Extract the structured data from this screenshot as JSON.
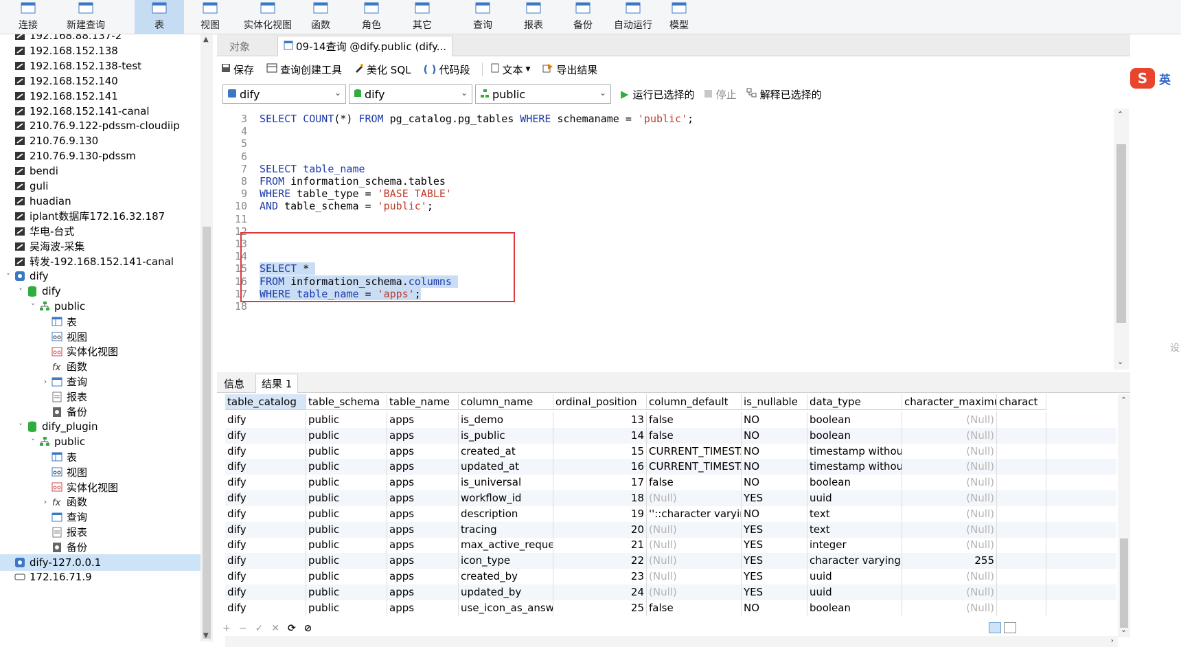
{
  "toolbar": {
    "items": [
      {
        "label": "连接",
        "icon": "plug-icon"
      },
      {
        "label": "新建查询",
        "icon": "new-query-icon"
      },
      {
        "label": "表",
        "icon": "table-icon",
        "active": true
      },
      {
        "label": "视图",
        "icon": "view-icon"
      },
      {
        "label": "实体化视图",
        "icon": "materialized-view-icon"
      },
      {
        "label": "函数",
        "icon": "function-icon"
      },
      {
        "label": "角色",
        "icon": "role-icon"
      },
      {
        "label": "其它",
        "icon": "other-icon"
      },
      {
        "label": "查询",
        "icon": "query-icon"
      },
      {
        "label": "报表",
        "icon": "report-icon"
      },
      {
        "label": "备份",
        "icon": "backup-icon"
      },
      {
        "label": "自动运行",
        "icon": "autorun-icon"
      },
      {
        "label": "模型",
        "icon": "model-icon"
      }
    ]
  },
  "tree": {
    "items": [
      {
        "label": "192.168.88.137-2",
        "icon": "connection-icon"
      },
      {
        "label": "192.168.152.138",
        "icon": "connection-icon"
      },
      {
        "label": "192.168.152.138-test",
        "icon": "connection-icon"
      },
      {
        "label": "192.168.152.140",
        "icon": "connection-icon"
      },
      {
        "label": "192.168.152.141",
        "icon": "connection-icon"
      },
      {
        "label": "192.168.152.141-canal",
        "icon": "connection-icon"
      },
      {
        "label": "210.76.9.122-pdssm-cloudiip",
        "icon": "connection-icon"
      },
      {
        "label": "210.76.9.130",
        "icon": "connection-icon"
      },
      {
        "label": "210.76.9.130-pdssm",
        "icon": "connection-icon"
      },
      {
        "label": "bendi",
        "icon": "connection-icon"
      },
      {
        "label": "guli",
        "icon": "connection-icon"
      },
      {
        "label": "huadian",
        "icon": "connection-icon"
      },
      {
        "label": "iplant数据库172.16.32.187",
        "icon": "connection-icon"
      },
      {
        "label": "华电-台式",
        "icon": "connection-icon"
      },
      {
        "label": "吴海波-采集",
        "icon": "connection-icon"
      },
      {
        "label": "转发-192.168.152.141-canal",
        "icon": "connection-icon"
      },
      {
        "label": "dify",
        "icon": "pg-connection-icon",
        "arrow": "˅"
      },
      {
        "label": "dify",
        "icon": "database-icon",
        "arrow": "˅"
      },
      {
        "label": "public",
        "icon": "schema-icon",
        "arrow": "˅"
      },
      {
        "label": "表",
        "icon": "table-icon"
      },
      {
        "label": "视图",
        "icon": "view-icon"
      },
      {
        "label": "实体化视图",
        "icon": "materialized-view-icon"
      },
      {
        "label": "函数",
        "icon": "function-icon"
      },
      {
        "label": "查询",
        "icon": "query-icon",
        "arrow": "›"
      },
      {
        "label": "报表",
        "icon": "report-icon"
      },
      {
        "label": "备份",
        "icon": "backup-icon"
      },
      {
        "label": "dify_plugin",
        "icon": "database-icon",
        "arrow": "˅"
      },
      {
        "label": "public",
        "icon": "schema-icon",
        "arrow": "˅"
      },
      {
        "label": "表",
        "icon": "table-icon"
      },
      {
        "label": "视图",
        "icon": "view-icon"
      },
      {
        "label": "实体化视图",
        "icon": "materialized-view-icon"
      },
      {
        "label": "函数",
        "icon": "function-icon",
        "arrow": "›"
      },
      {
        "label": "查询",
        "icon": "query-icon"
      },
      {
        "label": "报表",
        "icon": "report-icon"
      },
      {
        "label": "备份",
        "icon": "backup-icon"
      },
      {
        "label": "dify-127.0.0.1",
        "icon": "pg-connection-icon",
        "selected": true
      },
      {
        "label": "172.16.71.9",
        "icon": "server-icon"
      }
    ]
  },
  "tabs": {
    "objects": "对象",
    "query_tab": "09-14查询 @dify.public (dify..."
  },
  "editor_toolbar": {
    "save": "保存",
    "query_builder": "查询创建工具",
    "beautify": "美化 SQL",
    "snippet": "代码段",
    "text": "文本",
    "export": "导出结果"
  },
  "selectors": {
    "connection": "dify",
    "database": "dify",
    "schema": "public",
    "run_selected": "运行已选择的",
    "stop": "停止",
    "explain_selected": "解释已选择的"
  },
  "editor": {
    "lines": [
      {
        "n": "3",
        "code": [
          [
            "kw",
            "SELECT "
          ],
          [
            "fn",
            "COUNT"
          ],
          [
            "",
            "(*) "
          ],
          [
            "kw",
            "FROM"
          ],
          [
            "",
            " pg_catalog.pg_tables "
          ],
          [
            "kw",
            "WHERE"
          ],
          [
            "",
            " schemaname = "
          ],
          [
            "str",
            "'public'"
          ],
          [
            "",
            ";"
          ]
        ]
      },
      {
        "n": "4",
        "code": []
      },
      {
        "n": "5",
        "code": []
      },
      {
        "n": "6",
        "code": []
      },
      {
        "n": "7",
        "code": [
          [
            "kw",
            "SELECT "
          ],
          [
            "fn",
            "table_name"
          ]
        ]
      },
      {
        "n": "8",
        "code": [
          [
            "kw",
            "FROM"
          ],
          [
            "",
            " information_schema.tables"
          ]
        ]
      },
      {
        "n": "9",
        "code": [
          [
            "kw",
            "WHERE"
          ],
          [
            "",
            " table_type = "
          ],
          [
            "str",
            "'BASE TABLE'"
          ]
        ]
      },
      {
        "n": "10",
        "code": [
          [
            "kw",
            "AND"
          ],
          [
            "",
            " table_schema = "
          ],
          [
            "str",
            "'public'"
          ],
          [
            "",
            ";"
          ]
        ]
      },
      {
        "n": "11",
        "code": []
      },
      {
        "n": "12",
        "code": []
      },
      {
        "n": "13",
        "code": []
      },
      {
        "n": "14",
        "code": []
      },
      {
        "n": "15",
        "code": [
          [
            "kw",
            "SELECT"
          ],
          [
            "",
            " * "
          ]
        ],
        "hl": true
      },
      {
        "n": "16",
        "code": [
          [
            "kw",
            "FROM"
          ],
          [
            "",
            " information_schema."
          ],
          [
            "fn",
            "columns"
          ],
          [
            "",
            " "
          ]
        ],
        "hl": true
      },
      {
        "n": "17",
        "code": [
          [
            "kw",
            "WHERE"
          ],
          [
            "",
            " "
          ],
          [
            "fn",
            "table_name"
          ],
          [
            "",
            " = "
          ],
          [
            "str",
            "'apps'"
          ],
          [
            "",
            ";"
          ]
        ],
        "hl": true
      },
      {
        "n": "18",
        "code": []
      }
    ]
  },
  "result_tabs": {
    "info": "信息",
    "result1": "结果 1"
  },
  "grid": {
    "columns": [
      "table_catalog",
      "table_schema",
      "table_name",
      "column_name",
      "ordinal_position",
      "column_default",
      "is_nullable",
      "data_type",
      "character_maximum",
      "charact"
    ],
    "rows": [
      [
        "dify",
        "public",
        "apps",
        "is_demo",
        "13",
        "false",
        "NO",
        "boolean",
        "(Null)",
        ""
      ],
      [
        "dify",
        "public",
        "apps",
        "is_public",
        "14",
        "false",
        "NO",
        "boolean",
        "(Null)",
        ""
      ],
      [
        "dify",
        "public",
        "apps",
        "created_at",
        "15",
        "CURRENT_TIMESTAM",
        "NO",
        "timestamp without t",
        "(Null)",
        ""
      ],
      [
        "dify",
        "public",
        "apps",
        "updated_at",
        "16",
        "CURRENT_TIMESTAM",
        "NO",
        "timestamp without t",
        "(Null)",
        ""
      ],
      [
        "dify",
        "public",
        "apps",
        "is_universal",
        "17",
        "false",
        "NO",
        "boolean",
        "(Null)",
        ""
      ],
      [
        "dify",
        "public",
        "apps",
        "workflow_id",
        "18",
        "(Null)",
        "YES",
        "uuid",
        "(Null)",
        ""
      ],
      [
        "dify",
        "public",
        "apps",
        "description",
        "19",
        "''::character varying",
        "NO",
        "text",
        "(Null)",
        ""
      ],
      [
        "dify",
        "public",
        "apps",
        "tracing",
        "20",
        "(Null)",
        "YES",
        "text",
        "(Null)",
        ""
      ],
      [
        "dify",
        "public",
        "apps",
        "max_active_requests",
        "21",
        "(Null)",
        "YES",
        "integer",
        "(Null)",
        ""
      ],
      [
        "dify",
        "public",
        "apps",
        "icon_type",
        "22",
        "(Null)",
        "YES",
        "character varying",
        "255",
        ""
      ],
      [
        "dify",
        "public",
        "apps",
        "created_by",
        "23",
        "(Null)",
        "YES",
        "uuid",
        "(Null)",
        ""
      ],
      [
        "dify",
        "public",
        "apps",
        "updated_by",
        "24",
        "(Null)",
        "YES",
        "uuid",
        "(Null)",
        ""
      ],
      [
        "dify",
        "public",
        "apps",
        "use_icon_as_answer_",
        "25",
        "false",
        "NO",
        "boolean",
        "(Null)",
        ""
      ]
    ]
  },
  "bottom": {
    "add": "+",
    "remove": "−",
    "apply": "✓",
    "discard": "✕",
    "refresh": "⟳",
    "stop": "⊘"
  },
  "ime": {
    "label": "英"
  },
  "edge_text": "设"
}
